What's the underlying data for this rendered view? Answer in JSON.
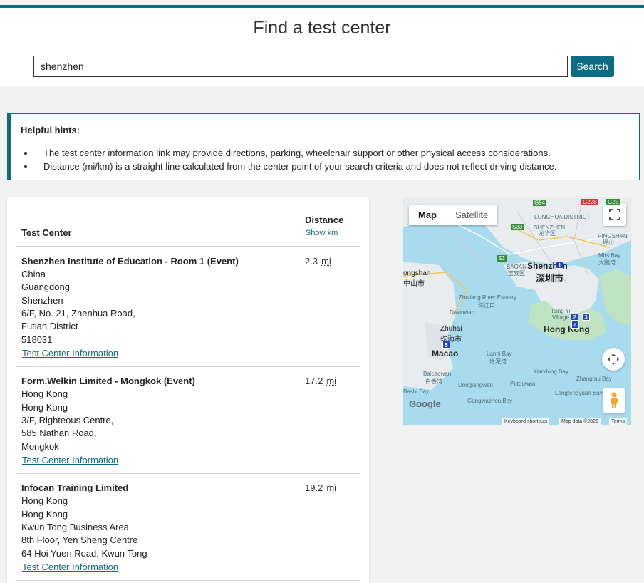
{
  "header": {
    "title": "Find a test center"
  },
  "search": {
    "value": "shenzhen",
    "button_label": "Search"
  },
  "hints": {
    "title": "Helpful hints:",
    "items": [
      "The test center information link may provide directions, parking, wheelchair support or other physical access considerations.",
      "Distance (mi/km) is a straight line calculated from the center point of your search criteria and does not reflect driving distance."
    ]
  },
  "results": {
    "col_center": "Test Center",
    "col_distance": "Distance",
    "show_km": "Show km",
    "link_label": "Test Center Information",
    "rows": [
      {
        "name": "Shenzhen Institute of Education - Room 1 (Event)",
        "lines": [
          "China",
          "Guangdong",
          "Shenzhen",
          "6/F, No. 21, Zhenhua Road,",
          "Futian District",
          "518031"
        ],
        "distance": "2.3",
        "unit": "mi"
      },
      {
        "name": "Form.Welkin Limited - Mongkok (Event)",
        "lines": [
          "Hong Kong",
          "Hong Kong",
          "3/F, Righteous Centre,",
          "585 Nathan Road,",
          "Mongkok"
        ],
        "distance": "17.2",
        "unit": "mi"
      },
      {
        "name": "Infocan Training Limited",
        "lines": [
          "Hong Kong",
          "Hong Kong",
          "Kwun Tong Business Area",
          "8th Floor, Yen Sheng Centre",
          "64 Hoi Yuen Road, Kwun Tong"
        ],
        "distance": "19.2",
        "unit": "mi"
      }
    ]
  },
  "map": {
    "type_map": "Map",
    "type_satellite": "Satellite",
    "cities": [
      "Shenzhen",
      "深圳市",
      "Hong Kong",
      "Macao",
      "Zhuhai",
      "珠海市",
      "ongshan",
      "中山市"
    ],
    "labels": [
      "Zhujiang River Estuary",
      "珠江口",
      "Dawuwan",
      "Lanni Bay",
      "烂泥湾",
      "Baicaowan",
      "白香湾",
      "Donglangwan",
      "Putouwan",
      "Xiaodong Bay",
      "Zhangmu Bay",
      "Lengfengyuan Bay",
      "Gangwazhou Bay",
      "Bashi Bay",
      "Mirs Bay",
      "大鹏湾",
      "PINGSHAN",
      "坪山",
      "LONGHUA DISTRICT",
      "SHENZHEN",
      "龙华区",
      "BAOAN",
      "宝安区",
      "Tsing Yi",
      "Village"
    ],
    "markers": [
      "1",
      "2",
      "3",
      "4",
      "5"
    ],
    "road_shields": [
      "G94",
      "G228",
      "G25",
      "S33",
      "S3"
    ],
    "attributions": [
      "Keyboard shortcuts",
      "Map data ©2026",
      "Terms"
    ],
    "google_logo": "Google",
    "colors": {
      "water": "#a9dbef",
      "land": "#e8ecef",
      "green": "#bfe3c0",
      "marker": "#2244cc",
      "accent": "#0e6b84"
    }
  }
}
